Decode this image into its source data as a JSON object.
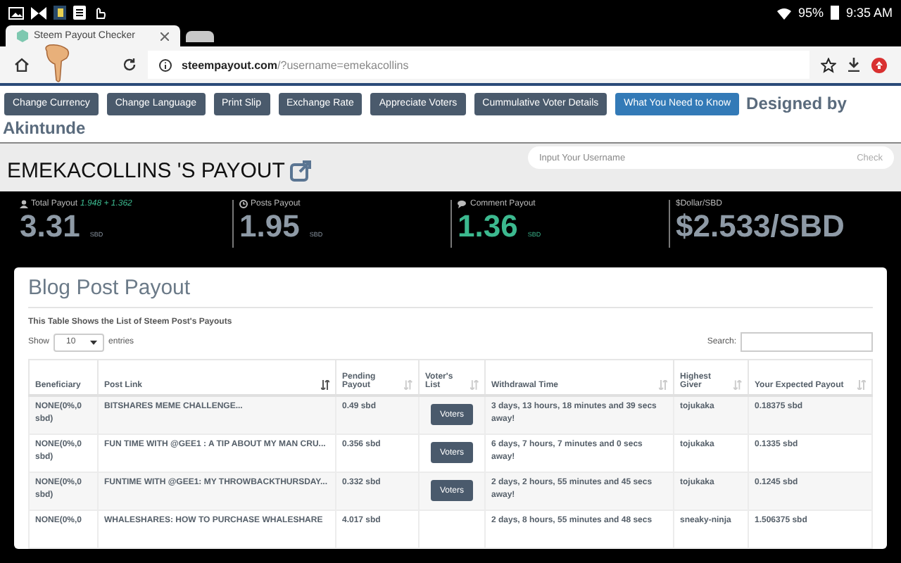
{
  "status_bar": {
    "battery": "95%",
    "time": "9:35 AM"
  },
  "browser": {
    "tabs": [
      {
        "title": "Steem Payout Checker",
        "selected": true
      },
      {
        "selected": false
      }
    ],
    "domain": "steempayout.com",
    "path": "/?username=emekacollins"
  },
  "toolbar": {
    "buttons": [
      {
        "label": "Change Currency",
        "kind": "default"
      },
      {
        "label": "Change Language",
        "kind": "default"
      },
      {
        "label": "Print Slip",
        "kind": "default"
      },
      {
        "label": "Exchange Rate",
        "kind": "default"
      },
      {
        "label": "Appreciate Voters",
        "kind": "default"
      },
      {
        "label": "Cummulative Voter Details",
        "kind": "default"
      },
      {
        "label": "What You Need to Know",
        "kind": "primary"
      }
    ],
    "credit": "Designed by",
    "author": "Akintunde"
  },
  "header": {
    "title": "EMEKACOLLINS 'S PAYOUT",
    "search": {
      "placeholder": "Input Your Username"
    },
    "check": "Check"
  },
  "stats": [
    {
      "kind": "total",
      "label": "Total Payout",
      "detail": "1.948 + 1.362",
      "value": "3.31",
      "unit": "SBD"
    },
    {
      "kind": "posts",
      "label": "Posts Payout",
      "value": "1.95",
      "unit": "SBD"
    },
    {
      "kind": "comments",
      "label": "Comment Payout",
      "value": "1.36",
      "unit": "SBD"
    },
    {
      "kind": "rate",
      "label": "$Dollar/SBD",
      "value": "$2.533/SBD"
    }
  ],
  "card": {
    "title": "Blog Post Payout",
    "caption": "This Table Shows the List of Steem Post's Payouts",
    "show_label": "Show",
    "page_size": "10",
    "entries_label": "entries",
    "search_label": "Search:",
    "table": {
      "columns": [
        {
          "label": "Beneficiary",
          "sortable": false,
          "sorted": false
        },
        {
          "label": "Post Link",
          "sortable": true,
          "sorted": true
        },
        {
          "label": "Pending Payout",
          "sortable": true,
          "sorted": false
        },
        {
          "label": "Voter's List",
          "sortable": true,
          "sorted": false
        },
        {
          "label": "Withdrawal Time",
          "sortable": true,
          "sorted": false
        },
        {
          "label": "Highest Giver",
          "sortable": true,
          "sorted": false
        },
        {
          "label": "Your Expected Payout",
          "sortable": true,
          "sorted": false
        }
      ],
      "rows": [
        {
          "beneficiary": "NONE(0%,0 sbd)",
          "post": "BITSHARES MEME CHALLENGE...",
          "pending": "0.49 sbd",
          "voters": "Voters",
          "withdrawal": "3 days, 13 hours, 18 minutes and 39 secs away!",
          "giver": "tojukaka",
          "expected": "0.18375 sbd"
        },
        {
          "beneficiary": "NONE(0%,0 sbd)",
          "post": "FUN TIME WITH @GEE1 : A TIP ABOUT MY MAN CRU...",
          "pending": "0.356 sbd",
          "voters": "Voters",
          "withdrawal": "6 days, 7 hours, 7 minutes and 0 secs away!",
          "giver": "tojukaka",
          "expected": "0.1335 sbd"
        },
        {
          "beneficiary": "NONE(0%,0 sbd)",
          "post": "FUNTIME WITH @GEE1: MY THROWBACKTHURSDAY...",
          "pending": "0.332 sbd",
          "voters": "Voters",
          "withdrawal": "2 days, 2 hours, 55 minutes and 45 secs away!",
          "giver": "tojukaka",
          "expected": "0.1245 sbd"
        },
        {
          "beneficiary": "NONE(0%,0",
          "post": "WHALESHARES: HOW TO PURCHASE WHALESHARE",
          "pending": "4.017 sbd",
          "withdrawal": "2 days, 8 hours, 55 minutes and 48 secs",
          "giver": "sneaky-ninja",
          "expected": "1.506375 sbd"
        }
      ]
    }
  }
}
